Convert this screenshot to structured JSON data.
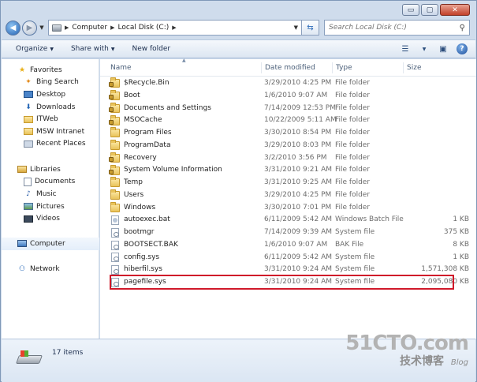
{
  "window": {
    "caption_buttons": {
      "minimize": "▭",
      "maximize": "▢",
      "close": "✕"
    }
  },
  "address_bar": {
    "crumbs": [
      "Computer",
      "Local Disk (C:)"
    ],
    "search_placeholder": "Search Local Disk (C:)"
  },
  "toolbar": {
    "organize_label": "Organize",
    "share_label": "Share with",
    "new_folder_label": "New folder"
  },
  "sidebar": {
    "favorites": {
      "label": "Favorites",
      "items": [
        "Bing Search",
        "Desktop",
        "Downloads",
        "ITWeb",
        "MSW Intranet",
        "Recent Places"
      ]
    },
    "libraries": {
      "label": "Libraries",
      "items": [
        "Documents",
        "Music",
        "Pictures",
        "Videos"
      ]
    },
    "computer": {
      "label": "Computer"
    },
    "network": {
      "label": "Network"
    }
  },
  "columns": {
    "name": "Name",
    "date": "Date modified",
    "type": "Type",
    "size": "Size"
  },
  "files": [
    {
      "name": "$Recycle.Bin",
      "date": "3/29/2010 4:25 PM",
      "type": "File folder",
      "size": "",
      "icon": "folder-locked-icon"
    },
    {
      "name": "Boot",
      "date": "1/6/2010 9:07 AM",
      "type": "File folder",
      "size": "",
      "icon": "folder-locked-icon"
    },
    {
      "name": "Documents and Settings",
      "date": "7/14/2009 12:53 PM",
      "type": "File folder",
      "size": "",
      "icon": "folder-locked-icon"
    },
    {
      "name": "MSOCache",
      "date": "10/22/2009 5:11 AM",
      "type": "File folder",
      "size": "",
      "icon": "folder-locked-icon"
    },
    {
      "name": "Program Files",
      "date": "3/30/2010 8:54 PM",
      "type": "File folder",
      "size": "",
      "icon": "folder-icon"
    },
    {
      "name": "ProgramData",
      "date": "3/29/2010 8:03 PM",
      "type": "File folder",
      "size": "",
      "icon": "folder-icon"
    },
    {
      "name": "Recovery",
      "date": "3/2/2010 3:56 PM",
      "type": "File folder",
      "size": "",
      "icon": "folder-locked-icon"
    },
    {
      "name": "System Volume Information",
      "date": "3/31/2010 9:21 AM",
      "type": "File folder",
      "size": "",
      "icon": "folder-locked-icon"
    },
    {
      "name": "Temp",
      "date": "3/31/2010 9:25 AM",
      "type": "File folder",
      "size": "",
      "icon": "folder-icon"
    },
    {
      "name": "Users",
      "date": "3/29/2010 4:25 PM",
      "type": "File folder",
      "size": "",
      "icon": "folder-icon"
    },
    {
      "name": "Windows",
      "date": "3/30/2010 7:01 PM",
      "type": "File folder",
      "size": "",
      "icon": "folder-icon"
    },
    {
      "name": "autoexec.bat",
      "date": "6/11/2009 5:42 AM",
      "type": "Windows Batch File",
      "size": "1 KB",
      "icon": "batch-file-icon"
    },
    {
      "name": "bootmgr",
      "date": "7/14/2009 9:39 AM",
      "type": "System file",
      "size": "375 KB",
      "icon": "system-file-icon"
    },
    {
      "name": "BOOTSECT.BAK",
      "date": "1/6/2010 9:07 AM",
      "type": "BAK File",
      "size": "8 KB",
      "icon": "file-icon"
    },
    {
      "name": "config.sys",
      "date": "6/11/2009 5:42 AM",
      "type": "System file",
      "size": "1 KB",
      "icon": "system-file-icon"
    },
    {
      "name": "hiberfil.sys",
      "date": "3/31/2010 9:24 AM",
      "type": "System file",
      "size": "1,571,308 KB",
      "icon": "system-file-icon"
    },
    {
      "name": "pagefile.sys",
      "date": "3/31/2010 9:24 AM",
      "type": "System file",
      "size": "2,095,080 KB",
      "icon": "system-file-icon"
    }
  ],
  "status": {
    "item_count": "17 items"
  },
  "watermark": {
    "logo": "51CTO.com",
    "sub": "技术博客",
    "blog": "Blog"
  },
  "colors": {
    "highlight": "#d0192a",
    "chrome": "#cfdcec"
  }
}
